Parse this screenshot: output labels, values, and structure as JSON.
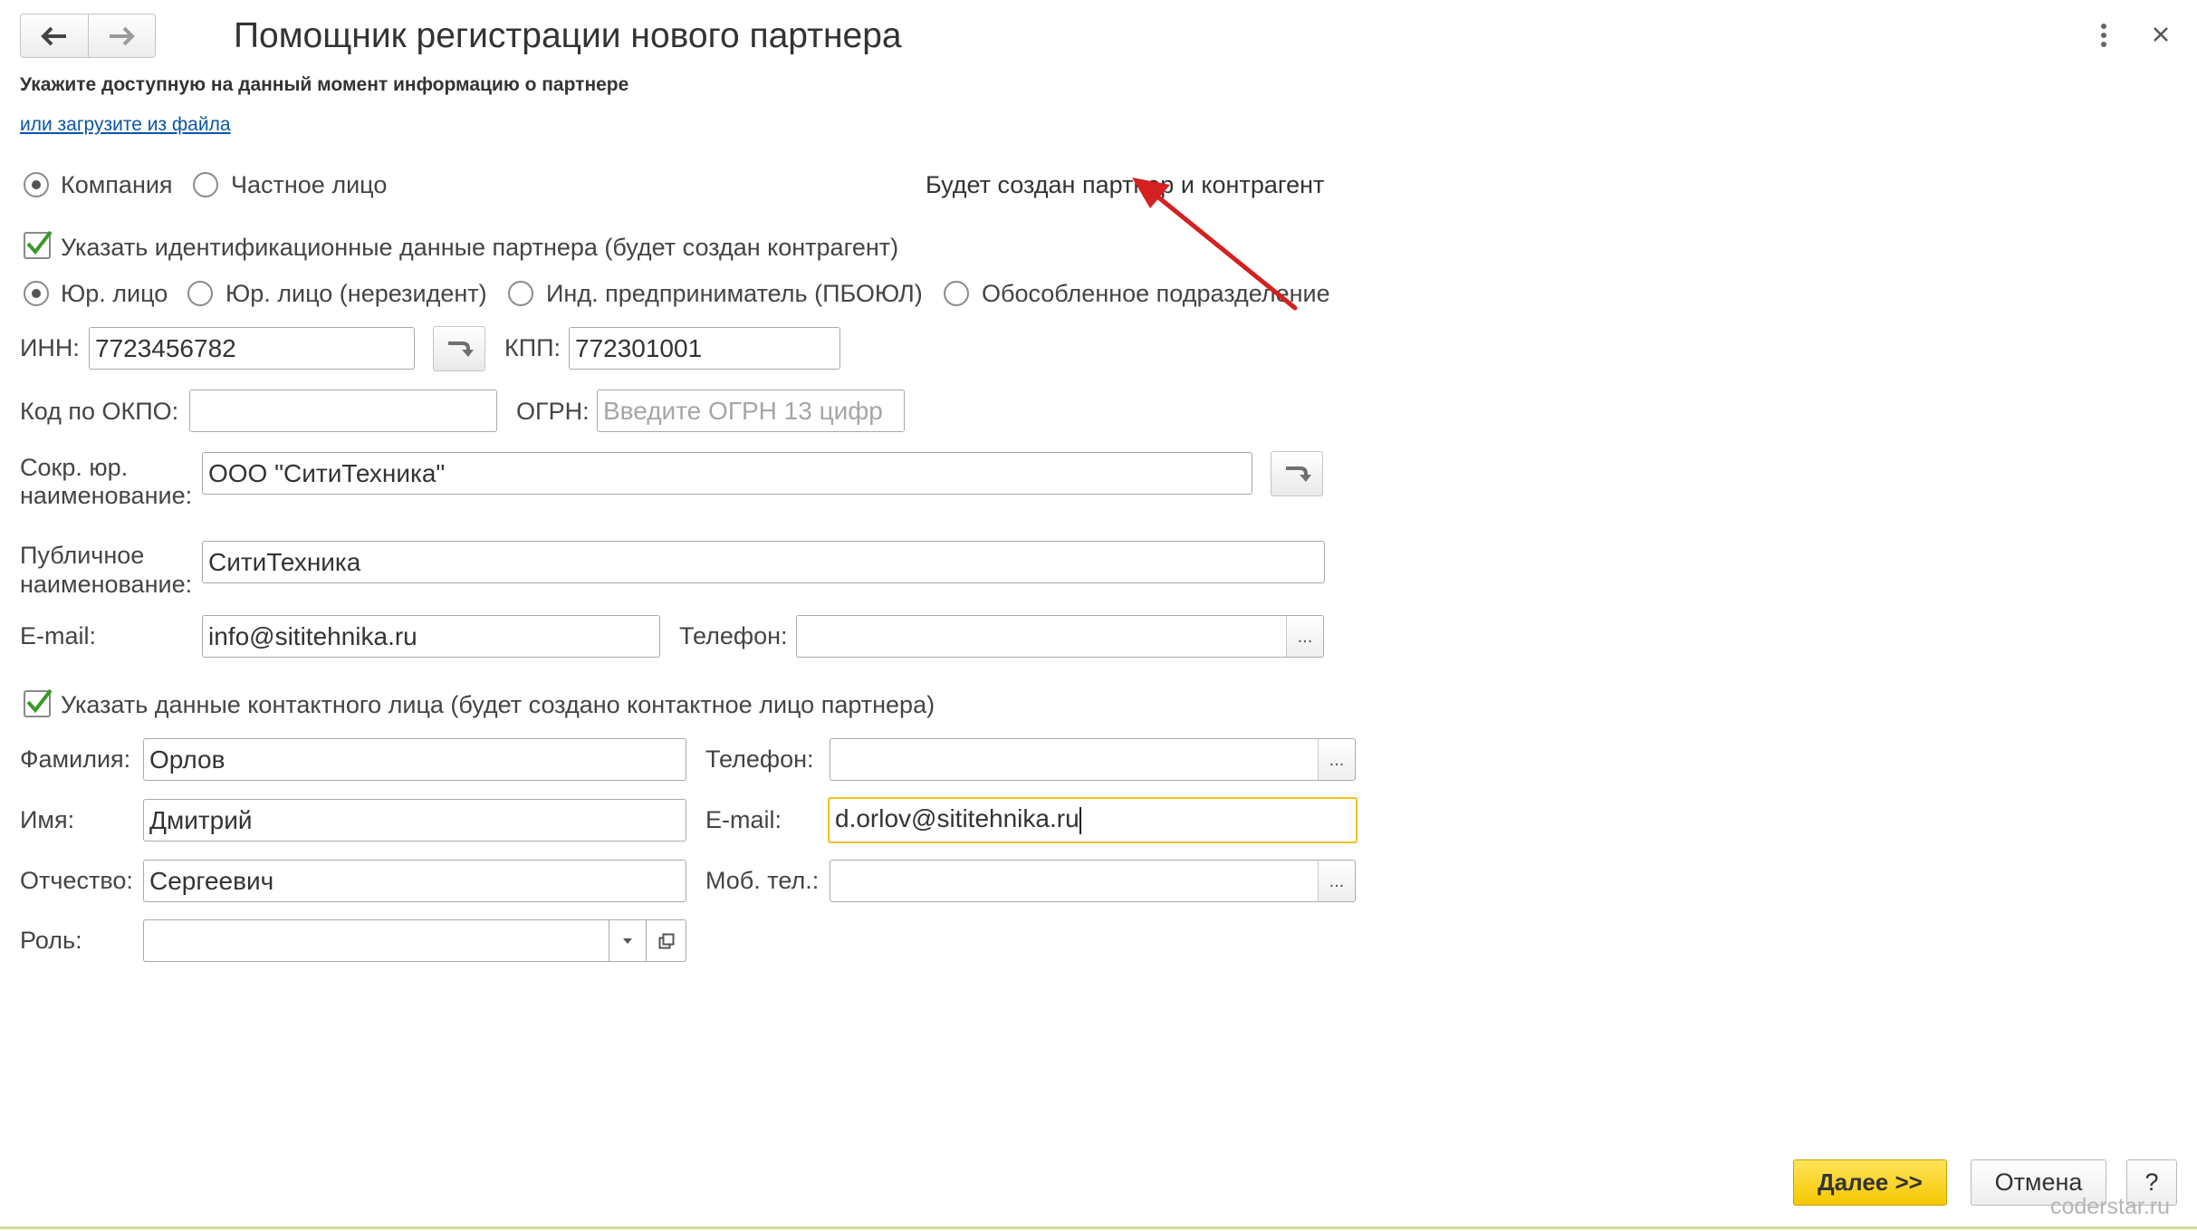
{
  "window": {
    "title": "Помощник регистрации нового партнера",
    "subtitle": "Укажите доступную на данный момент информацию о партнере",
    "load_link": "или загрузите из файла"
  },
  "partner_type": {
    "options": [
      "Компания",
      "Частное лицо"
    ],
    "selected": "Компания",
    "info_text": "Будет создан партнер и контрагент"
  },
  "identification": {
    "checkbox_label": "Указать идентификационные данные партнера (будет создан контрагент)",
    "checked": true,
    "legal_forms": [
      "Юр. лицо",
      "Юр. лицо (нерезидент)",
      "Инд. предприниматель (ПБОЮЛ)",
      "Обособленное подразделение"
    ],
    "selected_form": "Юр. лицо"
  },
  "company": {
    "inn_label": "ИНН:",
    "inn_value": "7723456782",
    "kpp_label": "КПП:",
    "kpp_value": "772301001",
    "okpo_label": "Код по ОКПО:",
    "okpo_value": "",
    "ogrn_label": "ОГРН:",
    "ogrn_placeholder": "Введите ОГРН 13 цифр",
    "short_name_label_1": "Сокр. юр.",
    "short_name_label_2": "наименование:",
    "short_name_value": "ООО \"СитиТехника\"",
    "public_name_label_1": "Публичное",
    "public_name_label_2": "наименование:",
    "public_name_value": "СитиТехника",
    "email_label": "E-mail:",
    "email_value": "info@sititehnika.ru",
    "phone_label": "Телефон:",
    "phone_value": ""
  },
  "contact": {
    "checkbox_label": "Указать данные контактного лица (будет создано контактное лицо партнера)",
    "checked": true,
    "last_name_label": "Фамилия:",
    "last_name_value": "Орлов",
    "first_name_label": "Имя:",
    "first_name_value": "Дмитрий",
    "middle_name_label": "Отчество:",
    "middle_name_value": "Сергеевич",
    "role_label": "Роль:",
    "role_value": "",
    "phone_label": "Телефон:",
    "phone_value": "",
    "email_label": "E-mail:",
    "email_value": "d.orlov@sititehnika.ru",
    "mobile_label": "Моб. тел.:",
    "mobile_value": ""
  },
  "footer": {
    "next_label": "Далее >>",
    "cancel_label": "Отмена",
    "help_label": "?",
    "watermark": "coderstar.ru"
  },
  "dots_label": "...",
  "colors": {
    "accent_yellow": "#f5c800",
    "focus_border": "#f3c316",
    "link_blue": "#0a56a6",
    "check_green": "#3a9a2a",
    "arrow_red": "#d42020"
  },
  "icons": [
    "back-arrow-icon",
    "forward-arrow-icon",
    "more-vertical-icon",
    "close-icon",
    "fill-by-inn-icon",
    "checkmark-icon",
    "dropdown-arrow-icon",
    "open-form-icon"
  ]
}
